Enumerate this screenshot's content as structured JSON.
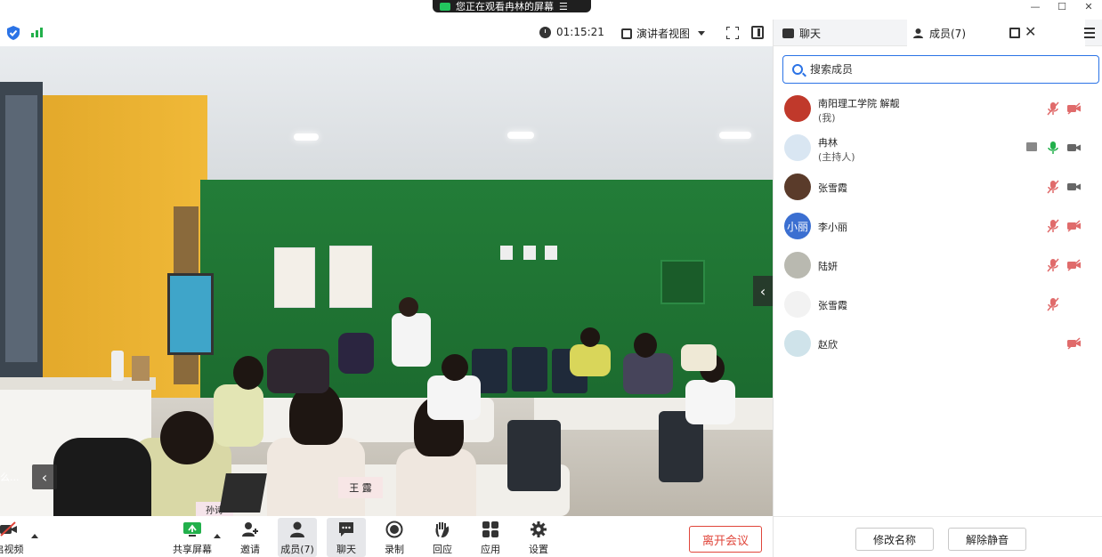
{
  "window": {
    "share_banner": "您正在观看冉林的屏幕",
    "controls": [
      "—",
      "☐",
      "✕"
    ]
  },
  "meeting": {
    "timer": "01:15:21",
    "view_mode": "演讲者视图"
  },
  "video": {
    "thumb_label": "么..."
  },
  "toolbar": {
    "start_video": "启视频",
    "share_screen": "共享屏幕",
    "invite": "邀请",
    "members": "成员(7)",
    "chat": "聊天",
    "record": "录制",
    "reactions": "回应",
    "apps": "应用",
    "settings": "设置",
    "leave": "离开会议"
  },
  "panel": {
    "tab_chat": "聊天",
    "tab_members": "成员(7)",
    "search_placeholder": "搜索成员",
    "members": [
      {
        "name": "南阳理工学院 解靓",
        "role": "(我)",
        "avatar_color": "#c0392b",
        "avatar_text": "",
        "mic": "muted",
        "cam": "off",
        "sharing": false
      },
      {
        "name": "冉林",
        "role": "(主持人)",
        "avatar_color": "#d9e6f2",
        "avatar_text": "",
        "mic": "active",
        "cam": "on",
        "sharing": true
      },
      {
        "name": "张雪霞",
        "role": "",
        "avatar_color": "#5a3b2a",
        "avatar_text": "",
        "mic": "muted",
        "cam": "on",
        "sharing": false
      },
      {
        "name": "李小丽",
        "role": "",
        "avatar_color": "#3b6fd1",
        "avatar_text": "小丽",
        "mic": "muted",
        "cam": "off",
        "sharing": false
      },
      {
        "name": "陆妍",
        "role": "",
        "avatar_color": "#b9b9b0",
        "avatar_text": "",
        "mic": "muted",
        "cam": "off",
        "sharing": false
      },
      {
        "name": "张雪霞",
        "role": "",
        "avatar_color": "#f2f2f2",
        "avatar_text": "",
        "mic": "muted",
        "cam": "none",
        "sharing": false
      },
      {
        "name": "赵欣",
        "role": "",
        "avatar_color": "#cfe3ea",
        "avatar_text": "",
        "mic": "none",
        "cam": "off",
        "sharing": false
      }
    ],
    "footer_rename": "修改名称",
    "footer_unmute": "解除静音"
  },
  "colors": {
    "accent": "#2b73e6",
    "danger": "#e0453a",
    "muted_icon": "#e06b6b",
    "active_mic": "#22b04b",
    "green_wall": "#1f7a35"
  }
}
